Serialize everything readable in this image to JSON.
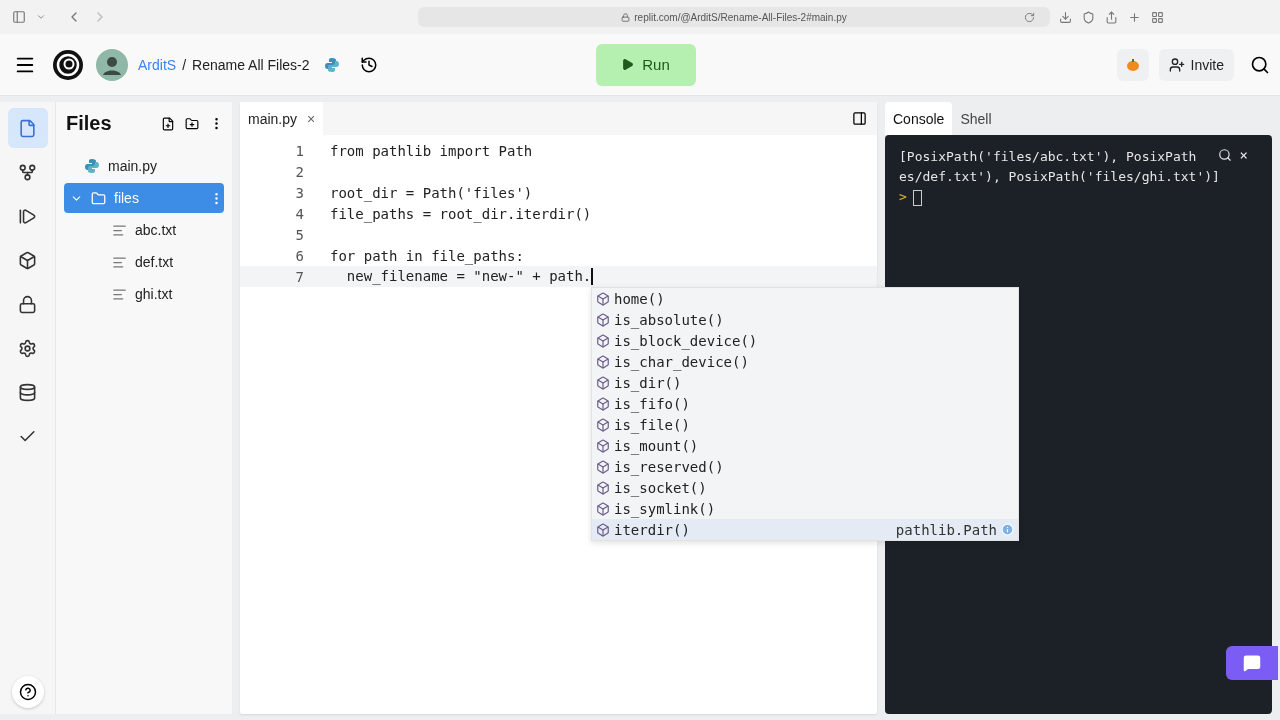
{
  "browser": {
    "url": "replit.com/@ArditS/Rename-All-Files-2#main.py"
  },
  "header": {
    "user": "ArditS",
    "separator": "/",
    "project": "Rename All Files-2",
    "run_label": "Run",
    "invite_label": "Invite"
  },
  "rail": [
    {
      "kind": "files",
      "selected": true
    },
    {
      "kind": "git",
      "selected": false
    },
    {
      "kind": "debugger",
      "selected": false
    },
    {
      "kind": "packages",
      "selected": false
    },
    {
      "kind": "secrets",
      "selected": false
    },
    {
      "kind": "settings",
      "selected": false
    },
    {
      "kind": "database",
      "selected": false
    },
    {
      "kind": "tests",
      "selected": false
    }
  ],
  "sidebar": {
    "title": "Files",
    "tree": [
      {
        "name": "main.py",
        "kind": "python",
        "selected": false
      },
      {
        "name": "files",
        "kind": "folder",
        "selected": true,
        "expanded": true,
        "children": [
          {
            "name": "abc.txt",
            "kind": "text",
            "selected": false
          },
          {
            "name": "def.txt",
            "kind": "text",
            "selected": false
          },
          {
            "name": "ghi.txt",
            "kind": "text",
            "selected": false
          }
        ]
      }
    ]
  },
  "editor": {
    "tab": {
      "label": "main.py",
      "close": "×"
    },
    "lines": [
      {
        "number": "1",
        "text": "from pathlib import Path",
        "active": false
      },
      {
        "number": "2",
        "active": false
      },
      {
        "number": "3",
        "text": "root_dir = Path('files')",
        "active": false
      },
      {
        "number": "4",
        "text": "file_paths = root_dir.iterdir()",
        "active": false
      },
      {
        "number": "5",
        "active": false
      },
      {
        "number": "6",
        "text": "for path in file_paths:",
        "active": false
      },
      {
        "number": "7",
        "text": "  new_filename = \"new-\" + path.",
        "active": true
      }
    ],
    "autocomplete": [
      {
        "label": "home()",
        "selected": false
      },
      {
        "label": "is_absolute()",
        "selected": false
      },
      {
        "label": "is_block_device()",
        "selected": false
      },
      {
        "label": "is_char_device()",
        "selected": false
      },
      {
        "label": "is_dir()",
        "selected": false
      },
      {
        "label": "is_fifo()",
        "selected": false
      },
      {
        "label": "is_file()",
        "selected": false
      },
      {
        "label": "is_mount()",
        "selected": false
      },
      {
        "label": "is_reserved()",
        "selected": false
      },
      {
        "label": "is_socket()",
        "selected": false
      },
      {
        "label": "is_symlink()",
        "selected": false
      },
      {
        "label": "iterdir()",
        "selected": true,
        "detail": "pathlib.Path"
      }
    ]
  },
  "console": {
    "tabs": [
      {
        "label": "Console",
        "selected": true
      },
      {
        "label": "Shell",
        "selected": false
      }
    ],
    "output": [
      "[PosixPath('files/abc.txt'), PosixPath",
      "es/def.txt'), PosixPath('files/ghi.txt')]"
    ],
    "close": "×",
    "prompt": ">"
  }
}
